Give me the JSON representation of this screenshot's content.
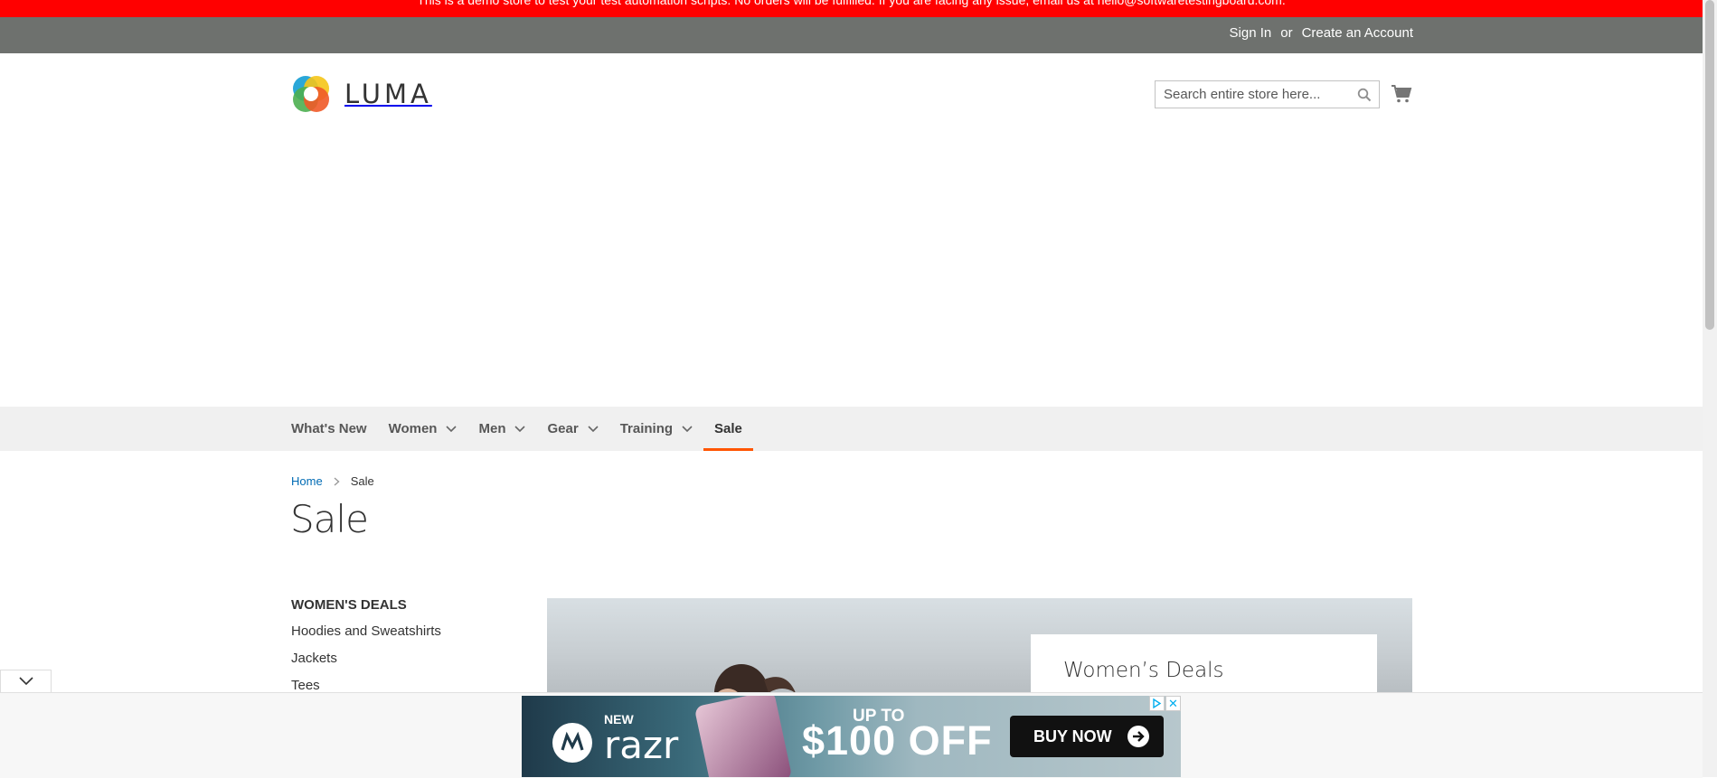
{
  "notice": {
    "text": "This is a demo store to test your test automation scripts. No orders will be fulfilled. If you are facing any issue, email us at hello@softwaretestingboard.com."
  },
  "header": {
    "sign_in": "Sign In",
    "or": "or",
    "create_account": "Create an Account"
  },
  "logo": {
    "text": "LUMA"
  },
  "search": {
    "placeholder": "Search entire store here..."
  },
  "nav": {
    "items": [
      {
        "label": "What's New"
      },
      {
        "label": "Women"
      },
      {
        "label": "Men"
      },
      {
        "label": "Gear"
      },
      {
        "label": "Training"
      },
      {
        "label": "Sale"
      }
    ]
  },
  "breadcrumb": {
    "home": "Home",
    "current": "Sale"
  },
  "page": {
    "title": "Sale"
  },
  "sidebar": {
    "heading": "WOMEN'S DEALS",
    "items": [
      {
        "label": "Hoodies and Sweatshirts"
      },
      {
        "label": "Jackets"
      },
      {
        "label": "Tees"
      }
    ]
  },
  "banner": {
    "card_title": "Women’s Deals"
  },
  "ad": {
    "new": "NEW",
    "brand": "razr",
    "up_to": "UP TO",
    "offer": "$100 OFF",
    "cta": "BUY NOW",
    "close": "✕"
  },
  "colors": {
    "notice_bg": "#ff0000",
    "header_bg": "#6e716e",
    "nav_bg": "#f0f0f0",
    "active_underline": "#ff5501",
    "link": "#006bb4"
  }
}
